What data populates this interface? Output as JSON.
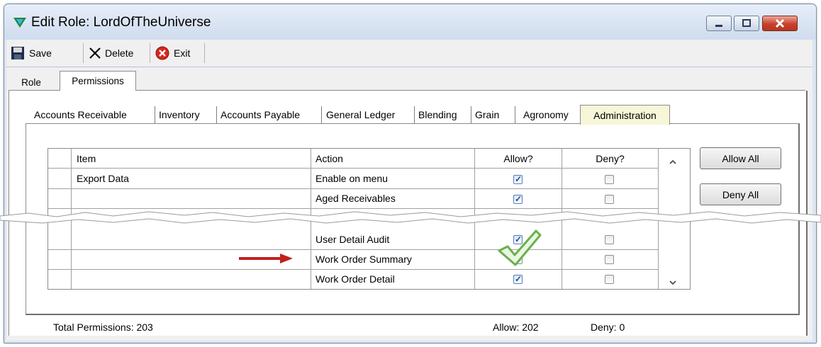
{
  "window": {
    "title": "Edit Role: LordOfTheUniverse",
    "caption_buttons": [
      "minimize",
      "maximize",
      "close"
    ]
  },
  "toolbar": {
    "save_label": "Save",
    "delete_label": "Delete",
    "exit_label": "Exit"
  },
  "outer_tabs": [
    {
      "label": "Role",
      "selected": false
    },
    {
      "label": "Permissions",
      "selected": true
    }
  ],
  "inner_tabs": [
    {
      "label": "Accounts Receivable",
      "selected": false
    },
    {
      "label": "Inventory",
      "selected": false
    },
    {
      "label": "Accounts Payable",
      "selected": false
    },
    {
      "label": "General Ledger",
      "selected": false
    },
    {
      "label": "Blending",
      "selected": false
    },
    {
      "label": "Grain",
      "selected": false
    },
    {
      "label": "Agronomy",
      "selected": false
    },
    {
      "label": "Administration",
      "selected": true
    }
  ],
  "grid": {
    "columns": [
      "Item",
      "Action",
      "Allow?",
      "Deny?"
    ],
    "rows_top": [
      {
        "item": "Export Data",
        "action": "Enable on menu",
        "allow": true,
        "deny": false
      },
      {
        "item": "",
        "action": "Aged Receivables",
        "allow": true,
        "deny": false
      }
    ],
    "rows_bottom": [
      {
        "item": "",
        "action": "User Detail Audit",
        "allow": true,
        "deny": false
      },
      {
        "item": "",
        "action": "Work Order Summary",
        "allow": false,
        "deny": false
      },
      {
        "item": "",
        "action": "Work Order Detail",
        "allow": true,
        "deny": false
      }
    ]
  },
  "buttons": {
    "allow_all": "Allow All",
    "deny_all": "Deny All"
  },
  "status": {
    "total": "Total Permissions: 203",
    "allow": "Allow: 202",
    "deny": "Deny: 0"
  },
  "colors": {
    "title_bg": "#dce6f2",
    "close_button": "#c8402a",
    "selected_tab": "#f8f6d8",
    "arrow": "#c0211f",
    "checkmark_overlay": "#6ab04c"
  }
}
